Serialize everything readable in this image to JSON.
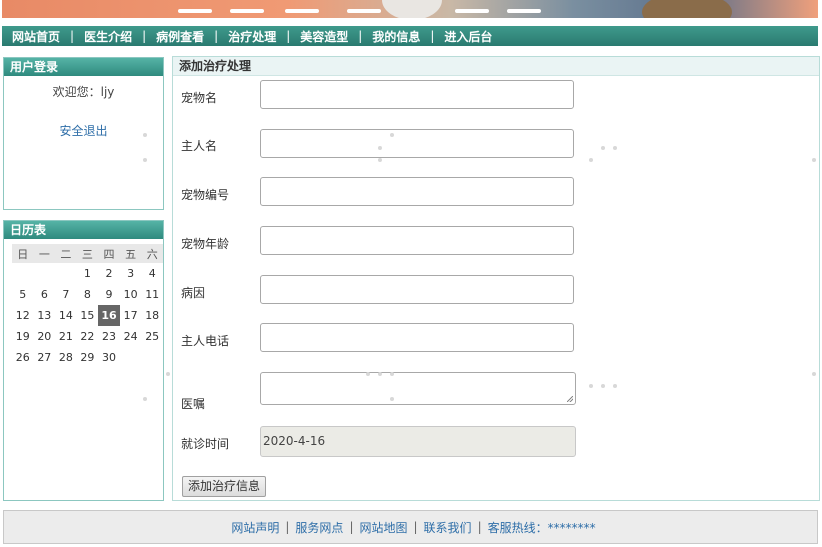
{
  "nav": {
    "items": [
      "网站首页",
      "医生介绍",
      "病例查看",
      "治疗处理",
      "美容造型",
      "我的信息",
      "进入后台"
    ],
    "separator": "|"
  },
  "login": {
    "title": "用户登录",
    "welcome": "欢迎您：ljy",
    "logout": "安全退出"
  },
  "calendar": {
    "title": "日历表",
    "weekdays": [
      "日",
      "一",
      "二",
      "三",
      "四",
      "五",
      "六"
    ],
    "weeks": [
      [
        "",
        "",
        "",
        "1",
        "2",
        "3",
        "4"
      ],
      [
        "5",
        "6",
        "7",
        "8",
        "9",
        "10",
        "11"
      ],
      [
        "12",
        "13",
        "14",
        "15",
        "16",
        "17",
        "18"
      ],
      [
        "19",
        "20",
        "21",
        "22",
        "23",
        "24",
        "25"
      ],
      [
        "26",
        "27",
        "28",
        "29",
        "30",
        "",
        ""
      ]
    ],
    "today": "16"
  },
  "form": {
    "title": "添加治疗处理",
    "pet_name_label": "宠物名",
    "owner_name_label": "主人名",
    "pet_id_label": "宠物编号",
    "pet_age_label": "宠物年龄",
    "illness_label": "病因",
    "owner_phone_label": "主人电话",
    "advice_label": "医嘱",
    "visit_time_label": "就诊时间",
    "visit_time_value": "2020-4-16",
    "submit_label": "添加治疗信息"
  },
  "footer": {
    "links": [
      "网站声明",
      "服务网点",
      "网站地图",
      "联系我们"
    ],
    "hotline": "客服热线：********"
  },
  "colors": {
    "nav_bg": "#2f8a7e",
    "panel_head": "#3f9a8c",
    "link": "#2e6ea8"
  }
}
